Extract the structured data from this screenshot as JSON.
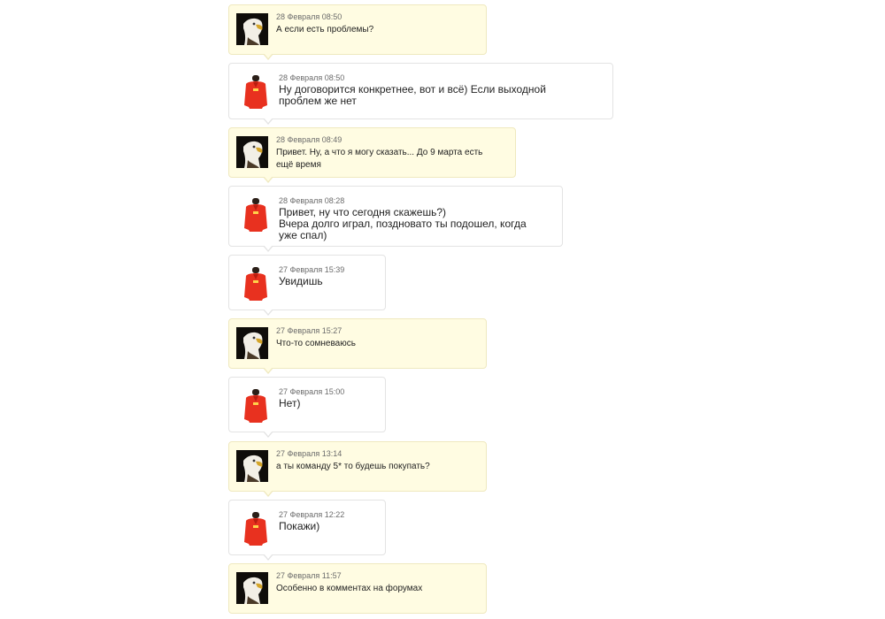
{
  "colors": {
    "own_bubble": "#fffce2",
    "other_bubble": "#ffffff",
    "other_avatar_shirt": "#e8311f"
  },
  "messages": [
    {
      "sender": "eagle",
      "date": "28 Февраля 08:50",
      "text": "А если есть проблемы?",
      "icon": "eagle-avatar-icon"
    },
    {
      "sender": "red",
      "date": "28 Февраля 08:50",
      "text": "Ну договорится конкретнее, вот и всё) Если выходной\nпроблем же нет",
      "icon": "red-hoodie-avatar-icon"
    },
    {
      "sender": "eagle",
      "date": "28 Февраля 08:49",
      "text": "Привет. Ну, а что я могу сказать... До 9 марта есть\nещё время",
      "icon": "eagle-avatar-icon"
    },
    {
      "sender": "red",
      "date": "28 Февраля 08:28",
      "text": "Привет, ну что сегодня скажешь?)\nВчера долго играл, поздновато ты подошел, когда\nуже спал)",
      "icon": "red-hoodie-avatar-icon"
    },
    {
      "sender": "red",
      "date": "27 Февраля 15:39",
      "text": "Увидишь",
      "icon": "red-hoodie-avatar-icon"
    },
    {
      "sender": "eagle",
      "date": "27 Февраля 15:27",
      "text": "Что-то сомневаюсь",
      "icon": "eagle-avatar-icon"
    },
    {
      "sender": "red",
      "date": "27 Февраля 15:00",
      "text": "Нет)",
      "icon": "red-hoodie-avatar-icon"
    },
    {
      "sender": "eagle",
      "date": "27 Февраля 13:14",
      "text": "а ты команду 5* то будешь покупать?",
      "icon": "eagle-avatar-icon"
    },
    {
      "sender": "red",
      "date": "27 Февраля 12:22",
      "text": "Покажи)",
      "icon": "red-hoodie-avatar-icon"
    },
    {
      "sender": "eagle",
      "date": "27 Февраля 11:57",
      "text": "Особенно в комментах на форумах",
      "icon": "eagle-avatar-icon"
    }
  ]
}
